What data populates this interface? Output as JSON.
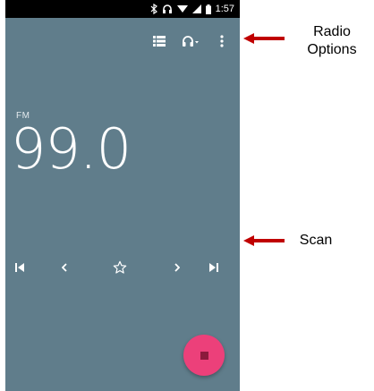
{
  "status_bar": {
    "time": "1:57",
    "icons": [
      "bluetooth-icon",
      "headset-icon",
      "wifi-icon",
      "signal-icon",
      "battery-icon"
    ]
  },
  "toolbar": {
    "icons": [
      "station-list-icon",
      "headset-output-icon",
      "overflow-menu-icon"
    ]
  },
  "tuner": {
    "band": "FM",
    "frequency": "99.0"
  },
  "controls": {
    "icons": [
      "skip-previous-icon",
      "seek-back-icon",
      "favorite-star-icon",
      "seek-forward-icon",
      "skip-next-icon"
    ]
  },
  "fab": {
    "icon": "stop-icon",
    "color": "#ec407a"
  },
  "annotations": {
    "radio_options_line1": "Radio",
    "radio_options_line2": "Options",
    "scan": "Scan"
  },
  "colors": {
    "background": "#607d8b",
    "status_bar": "#000000",
    "arrow": "#c00000"
  }
}
